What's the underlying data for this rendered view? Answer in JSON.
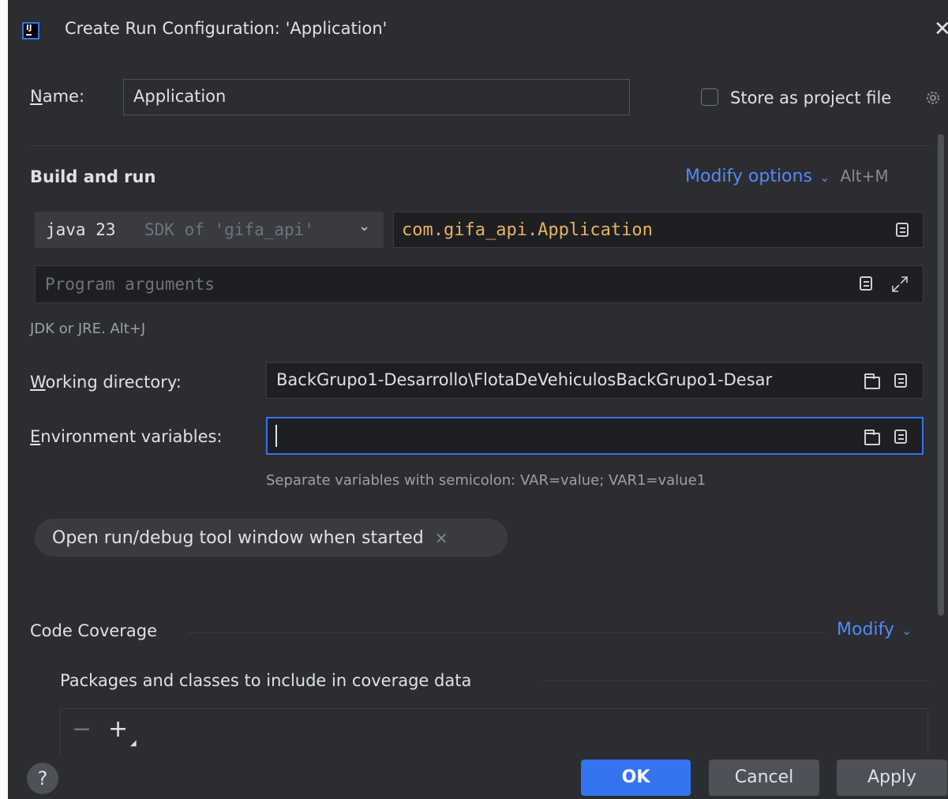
{
  "window": {
    "title": "Create Run Configuration: 'Application'",
    "close_glyph": "✕"
  },
  "name_row": {
    "label_mnemonic": "N",
    "label_rest": "ame:",
    "value": "Application",
    "store_label": "Store as project file"
  },
  "build_and_run": {
    "title": "Build and run",
    "modify_options": "Modify options",
    "modify_shortcut": "Alt+M",
    "sdk_version": "java 23",
    "sdk_suffix": "SDK of 'gifa_api'",
    "main_class": "com.gifa_api.Application",
    "program_args_placeholder": "Program arguments",
    "jdk_hint": "JDK or JRE. Alt+J"
  },
  "working_directory": {
    "label_mnemonic": "W",
    "label_rest": "orking directory:",
    "value": "BackGrupo1-Desarrollo\\FlotaDeVehiculosBackGrupo1-Desar"
  },
  "environment_variables": {
    "label_mnemonic": "E",
    "label_rest": "nvironment variables:",
    "value": "",
    "hint": "Separate variables with semicolon: VAR=value; VAR1=value1"
  },
  "chip": {
    "label": "Open run/debug tool window when started",
    "remove_glyph": "×"
  },
  "code_coverage": {
    "title": "Code Coverage",
    "modify": "Modify",
    "packages_label": "Packages and classes to include in coverage data"
  },
  "footer": {
    "help": "?",
    "ok": "OK",
    "cancel": "Cancel",
    "apply": "Apply"
  },
  "colors": {
    "background": "#2b2d30",
    "accent": "#3574f0",
    "link": "#548af7",
    "main_class": "#e8b35e"
  }
}
